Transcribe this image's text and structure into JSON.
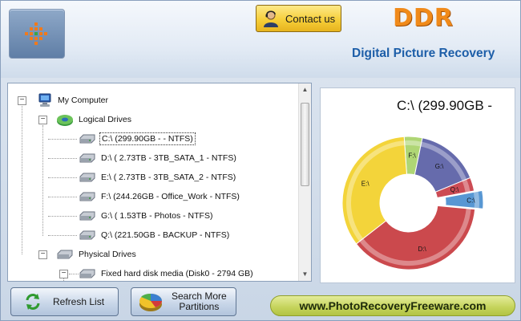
{
  "header": {
    "contact_label": "Contact us",
    "brand": "DDR",
    "product_name": "Digital Picture Recovery"
  },
  "tree": {
    "root": "My Computer",
    "logical_group": "Logical Drives",
    "logical_drives": [
      {
        "label": "C:\\ (299.90GB -  - NTFS)",
        "selected": true
      },
      {
        "label": "D:\\ (  2.73TB - 3TB_SATA_1 - NTFS)",
        "selected": false
      },
      {
        "label": "E:\\ (  2.73TB - 3TB_SATA_2 - NTFS)",
        "selected": false
      },
      {
        "label": "F:\\ (244.26GB - Office_Work - NTFS)",
        "selected": false
      },
      {
        "label": "G:\\ (  1.53TB - Photos - NTFS)",
        "selected": false
      },
      {
        "label": "Q:\\ (221.50GB - BACKUP - NTFS)",
        "selected": false
      }
    ],
    "physical_group": "Physical Drives",
    "physical_drives": [
      {
        "label": "Fixed hard disk media (Disk0 - 2794 GB)"
      }
    ]
  },
  "chart_data": {
    "type": "pie",
    "title": "C:\\ (299.90GB -",
    "categories": [
      "F:\\",
      "G:\\",
      "Q:\\",
      "C:\\",
      "D:\\",
      "E:\\"
    ],
    "values": [
      4.4,
      15.5,
      3.3,
      4.4,
      38.0,
      34.4
    ],
    "colors": [
      "#a9d36a",
      "#5a5fa6",
      "#c83c46",
      "#4a8fd0",
      "#c73a3e",
      "#f2d12a"
    ],
    "highlighted": "C:\\"
  },
  "footer": {
    "refresh_label": "Refresh List",
    "search_label_line1": "Search More",
    "search_label_line2": "Partitions",
    "website": "www.PhotoRecoveryFreeware.com"
  }
}
